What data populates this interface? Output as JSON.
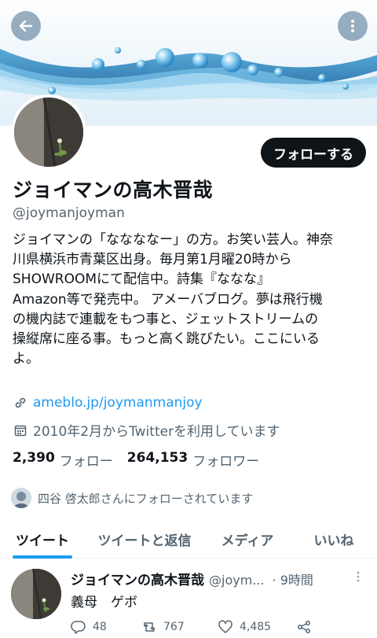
{
  "header": {
    "back_icon": "arrow-left-icon",
    "more_icon": "more-vertical-icon"
  },
  "profile": {
    "follow_button": "フォローする",
    "display_name": "ジョイマンの高木晋哉",
    "handle": "@joymanjoyman",
    "bio_lines": [
      "ジョイマンの「ななななー」の方。お笑い芸人。神奈",
      "川県横浜市青葉区出身。毎月第1月曜20時から",
      "SHOWROOMにて配信中。詩集『ななな』",
      "Amazon等で発売中。 アメーバブログ。夢は飛行機",
      "の機内誌で連載をもつ事と、ジェットストリームの",
      "操縦席に座る事。もっと高く跳びたい。ここにいる",
      "よ。"
    ],
    "link": "ameblo.jp/joymanmanjoy",
    "joined": "2010年2月からTwitterを利用しています",
    "following_count": "2,390",
    "following_label": "フォロー",
    "followers_count": "264,153",
    "followers_label": "フォロワー",
    "followed_by": "四谷 啓太郎さんにフォローされています"
  },
  "tabs": [
    {
      "label": "ツイート",
      "active": true
    },
    {
      "label": "ツイートと返信",
      "active": false
    },
    {
      "label": "メディア",
      "active": false
    },
    {
      "label": "いいね",
      "active": false
    }
  ],
  "tweet": {
    "name": "ジョイマンの高木晋哉",
    "handle": "@joym...",
    "time": "· 9時間",
    "text": "義母　ゲボ",
    "replies": "48",
    "retweets": "767",
    "likes": "4,485"
  },
  "colors": {
    "accent": "#1d9bf0",
    "text_primary": "#0f1419",
    "text_secondary": "#536471",
    "follow_button_bg": "#0f1419"
  }
}
